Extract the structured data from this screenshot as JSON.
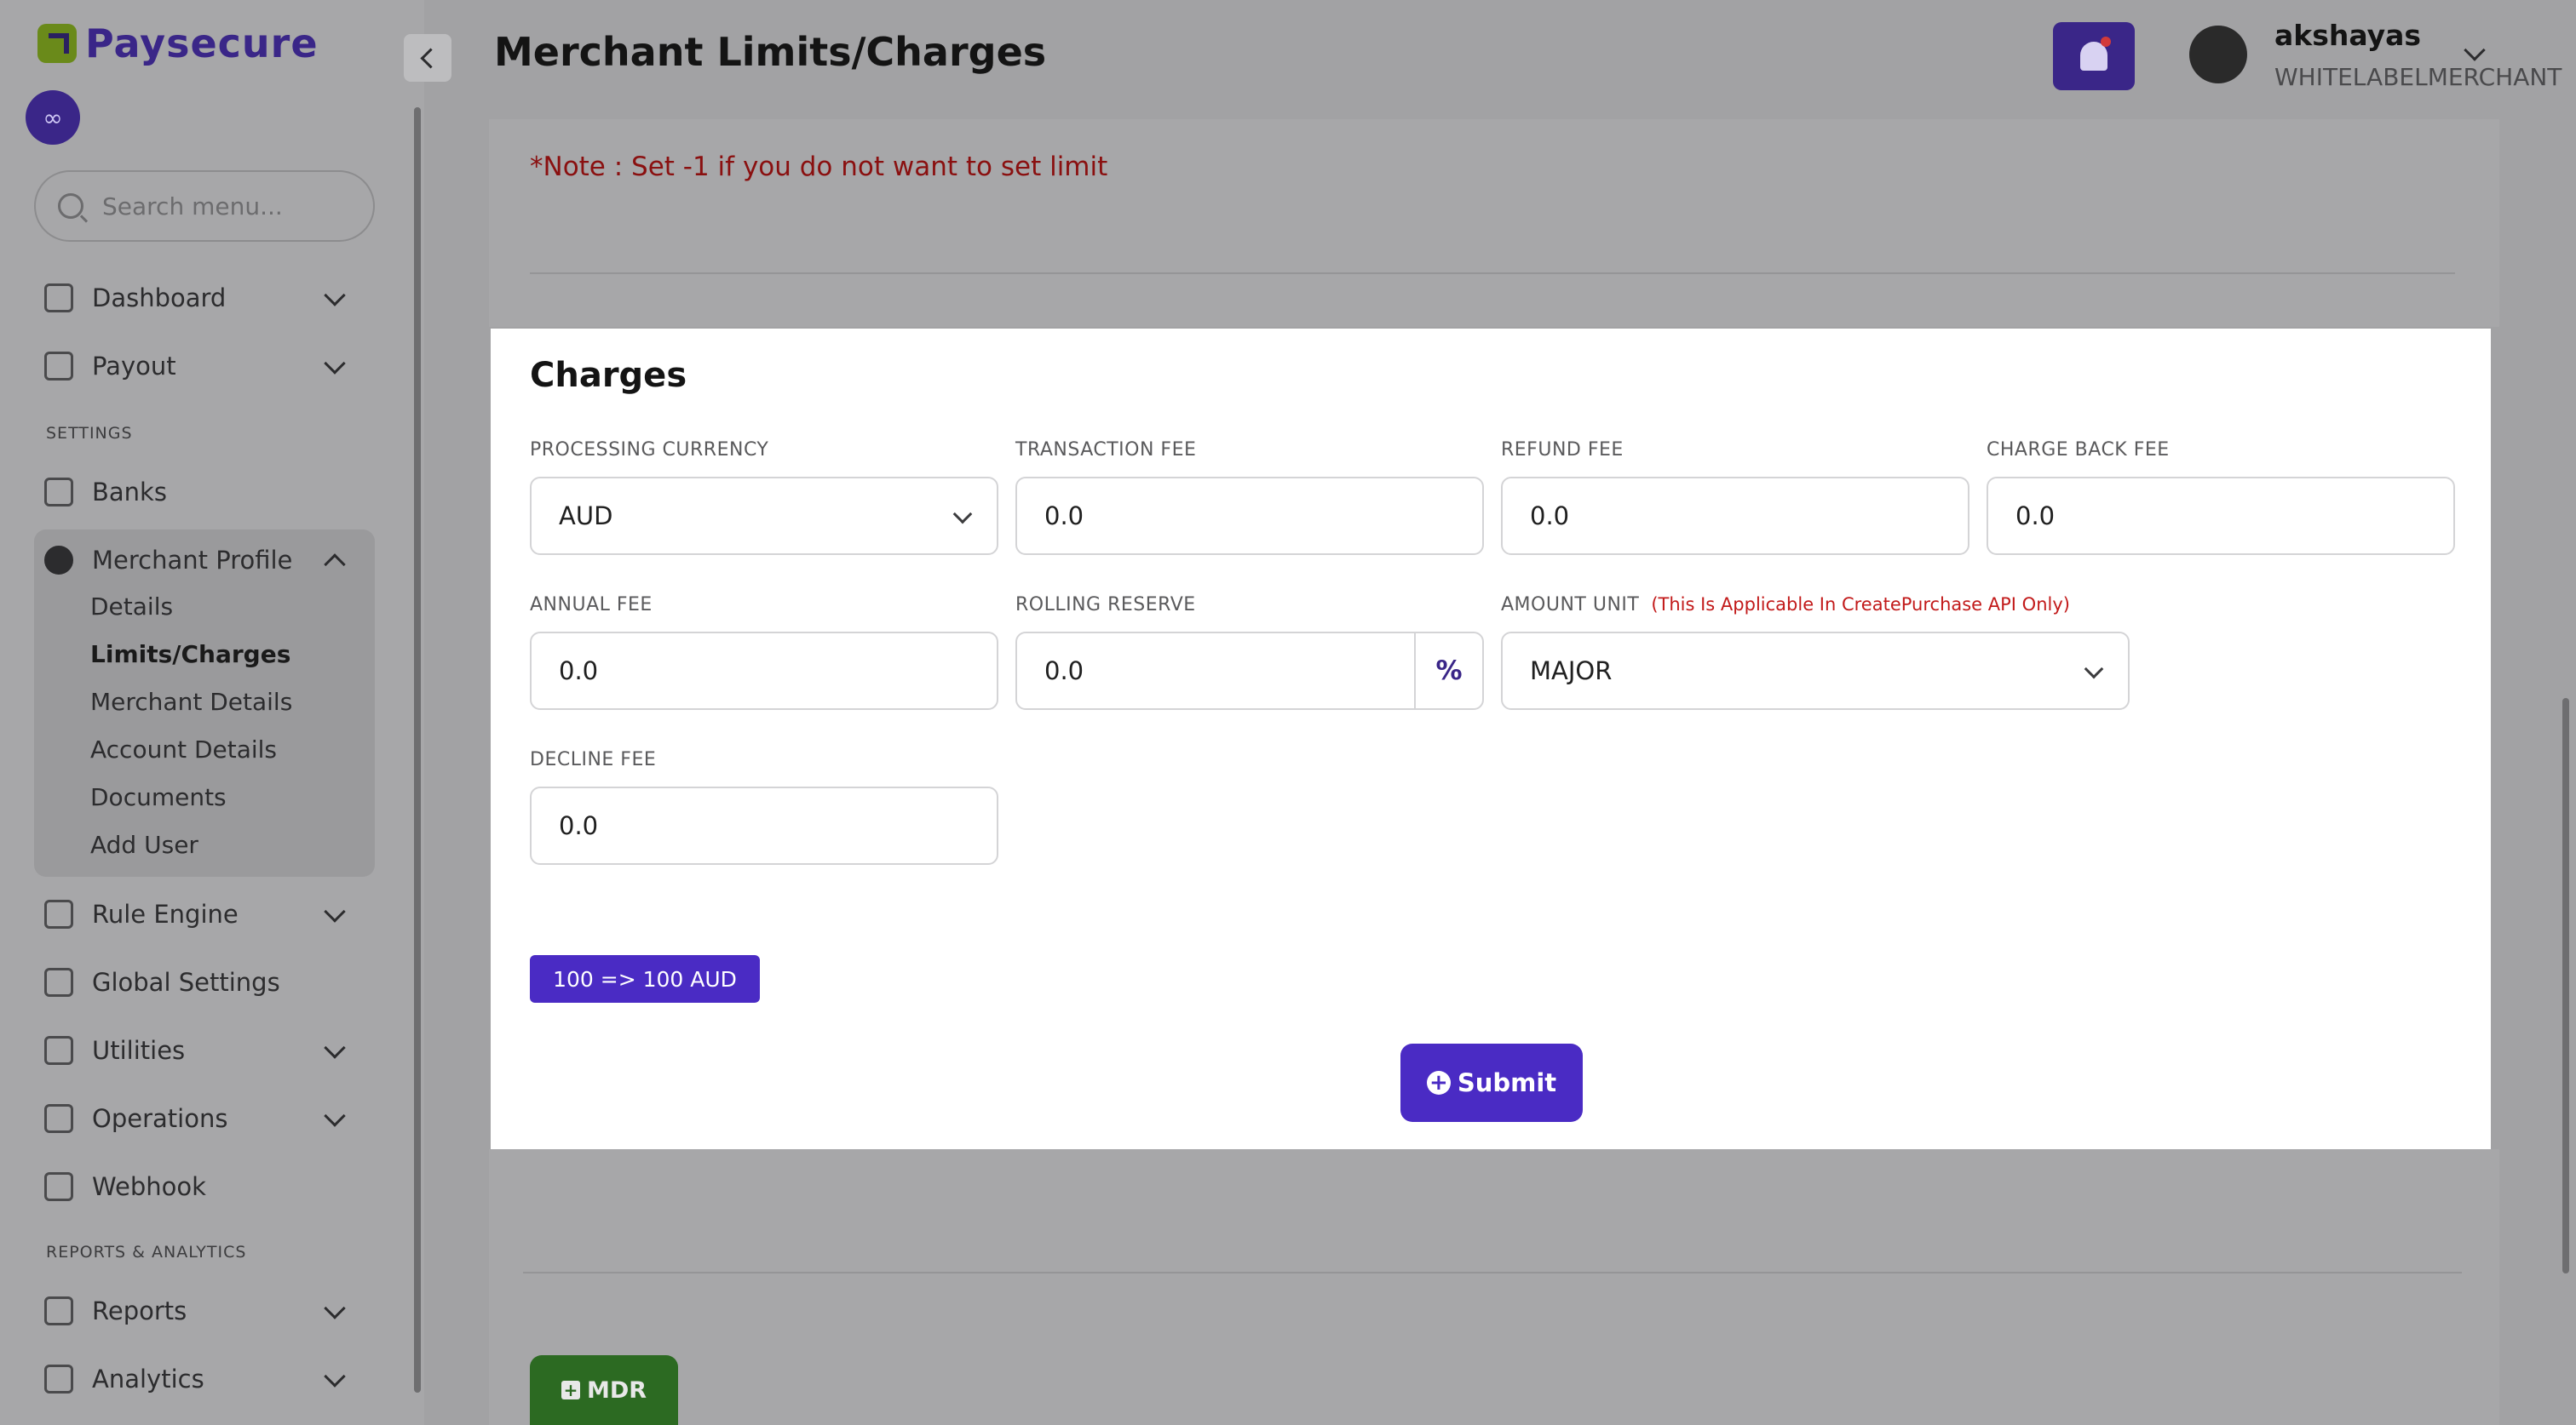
{
  "brand": {
    "name": "Paysecure"
  },
  "search": {
    "placeholder": "Search menu..."
  },
  "sidebar": {
    "items": [
      {
        "label": "Dashboard",
        "icon": "dashboard-icon"
      },
      {
        "label": "Payout",
        "icon": "payout-icon"
      },
      {
        "label": "Banks",
        "icon": "bank-icon"
      },
      {
        "label": "Merchant Profile",
        "icon": "user-icon"
      },
      {
        "label": "Rule Engine",
        "icon": "rule-engine-icon"
      },
      {
        "label": "Global Settings",
        "icon": "global-settings-icon"
      },
      {
        "label": "Utilities",
        "icon": "utilities-icon"
      },
      {
        "label": "Operations",
        "icon": "operations-icon"
      },
      {
        "label": "Webhook",
        "icon": "webhook-icon"
      },
      {
        "label": "Reports",
        "icon": "reports-icon"
      },
      {
        "label": "Analytics",
        "icon": "analytics-icon"
      }
    ],
    "sections": {
      "settings": "SETTINGS",
      "reports": "REPORTS & ANALYTICS"
    },
    "merchant_profile_sub": [
      "Details",
      "Limits/Charges",
      "Merchant Details",
      "Account Details",
      "Documents",
      "Add User"
    ]
  },
  "header": {
    "title": "Merchant Limits/Charges",
    "user_name": "akshayas",
    "user_role": "WHITELABELMERCHANT"
  },
  "note": "*Note : Set -1 if you do not want to set limit",
  "charges": {
    "title": "Charges",
    "processing_currency": {
      "label": "PROCESSING CURRENCY",
      "value": "AUD"
    },
    "transaction_fee": {
      "label": "TRANSACTION FEE",
      "value": "0.0"
    },
    "refund_fee": {
      "label": "REFUND FEE",
      "value": "0.0"
    },
    "charge_back_fee": {
      "label": "CHARGE BACK FEE",
      "value": "0.0"
    },
    "annual_fee": {
      "label": "ANNUAL FEE",
      "value": "0.0"
    },
    "rolling_reserve": {
      "label": "ROLLING RESERVE",
      "value": "0.0",
      "suffix": "%"
    },
    "amount_unit": {
      "label": "AMOUNT UNIT",
      "note": "(This Is Applicable In CreatePurchase API Only)",
      "value": "MAJOR"
    },
    "decline_fee": {
      "label": "DECLINE FEE",
      "value": "0.0"
    },
    "unit_example": "100 => 100 AUD",
    "submit_label": "Submit"
  },
  "mdr_label": "MDR",
  "colors": {
    "primary": "#4a2bc4",
    "note_red": "#8a1010",
    "mdr_green": "#2c6a22"
  }
}
